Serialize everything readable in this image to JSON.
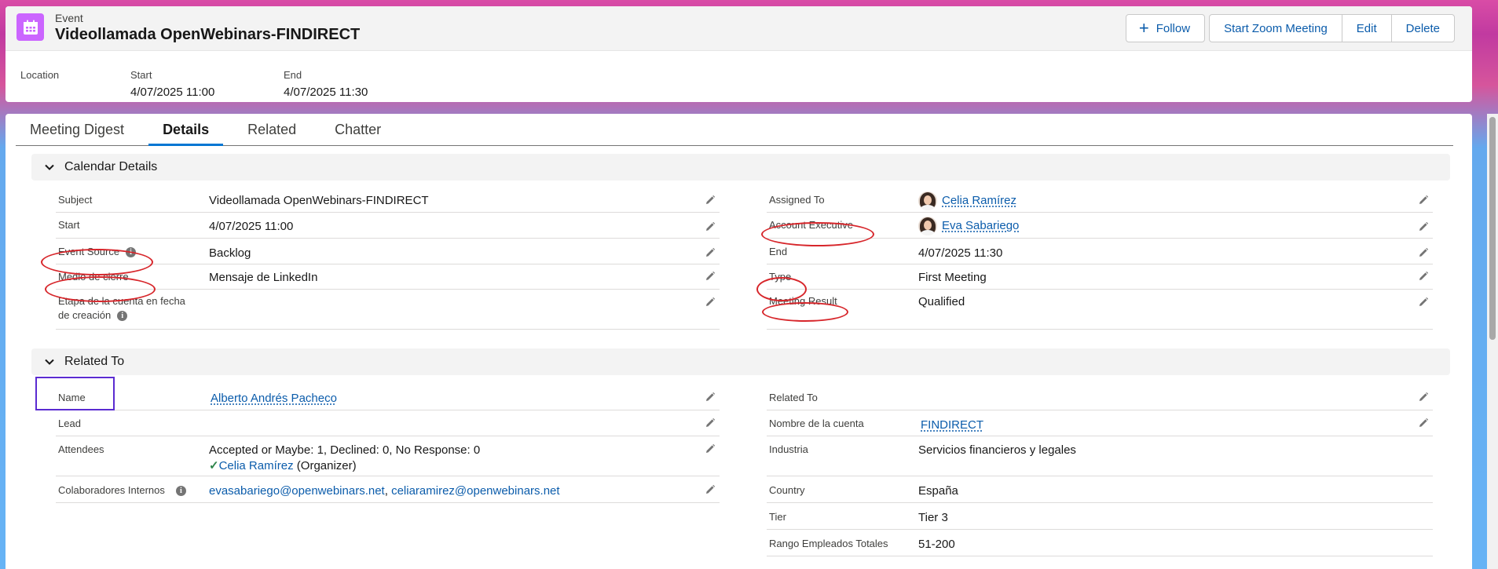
{
  "header": {
    "object_type": "Event",
    "title": "Videollamada OpenWebinars-FINDIRECT",
    "actions": {
      "follow": "Follow",
      "zoom": "Start Zoom Meeting",
      "edit": "Edit",
      "delete": "Delete"
    },
    "highlights": {
      "location_label": "Location",
      "start_label": "Start",
      "start_value": "4/07/2025 11:00",
      "end_label": "End",
      "end_value": "4/07/2025 11:30"
    }
  },
  "tabs": [
    "Meeting Digest",
    "Details",
    "Related",
    "Chatter"
  ],
  "calendar": {
    "title": "Calendar Details",
    "subject_label": "Subject",
    "subject_value": "Videollamada OpenWebinars-FINDIRECT",
    "start_label": "Start",
    "start_value": "4/07/2025 11:00",
    "event_source_label": "Event Source",
    "event_source_value": "Backlog",
    "medio_label": "Medio de cierre",
    "medio_value": "Mensaje de LinkedIn",
    "etapa_label_1": "Etapa de la cuenta en fecha",
    "etapa_label_2": "de creación",
    "assigned_label": "Assigned To",
    "assigned_value": "Celia Ramírez",
    "ae_label": "Account Executive",
    "ae_value": "Eva Sabariego",
    "end_label": "End",
    "end_value": "4/07/2025 11:30",
    "type_label": "Type",
    "type_value": "First Meeting",
    "result_label": "Meeting Result",
    "result_value": "Qualified"
  },
  "related": {
    "title": "Related To",
    "name_label": "Name",
    "name_value": "Alberto Andrés Pacheco",
    "lead_label": "Lead",
    "attendees_label": "Attendees",
    "attendees_value": "Accepted or Maybe: 1, Declined: 0, No Response: 0",
    "organizer_name": "Celia Ramírez",
    "organizer_suffix": "(Organizer)",
    "colab_label": "Colaboradores Internos",
    "colab_email_1": "evasabariego@openwebinars.net",
    "colab_sep": ",",
    "colab_email_2": "celiaramirez@openwebinars.net",
    "related_to_label": "Related To",
    "cuenta_label": "Nombre de la cuenta",
    "cuenta_value": "FINDIRECT",
    "industria_label": "Industria",
    "industria_value": "Servicios financieros y legales",
    "country_label": "Country",
    "country_value": "España",
    "tier_label": "Tier",
    "tier_value": "Tier 3",
    "rango_label": "Rango Empleados Totales",
    "rango_value": "51-200"
  },
  "colors": {
    "brand_blue": "#0176d3",
    "link_blue": "#0b5cab",
    "event_icon": "#cb65ff",
    "annotation_red": "#d7262b",
    "annotation_purple": "#5b2bd1"
  }
}
